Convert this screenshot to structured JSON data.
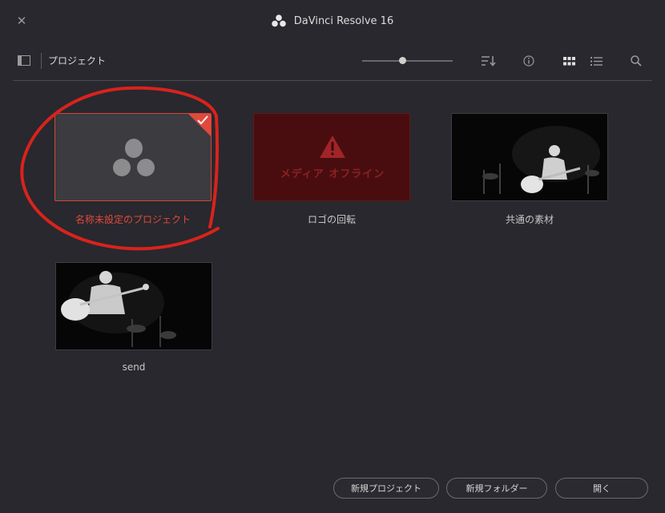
{
  "window": {
    "title": "DaVinci Resolve 16",
    "close_label": "✕"
  },
  "toolbar": {
    "breadcrumb": "プロジェクト",
    "zoom_level": 0.44,
    "icons": [
      "sidebar-toggle-icon",
      "sort-icon",
      "info-icon",
      "grid-view-icon",
      "list-view-icon",
      "search-icon"
    ]
  },
  "projects": [
    {
      "label": "名称未設定のプロジェクト",
      "state": "selected"
    },
    {
      "label": "ロゴの回転",
      "state": "offline",
      "overlay_text": "メディア オフライン"
    },
    {
      "label": "共通の素材",
      "state": "thumbnail"
    },
    {
      "label": "send",
      "state": "thumbnail"
    }
  ],
  "buttons": {
    "new_project": "新規プロジェクト",
    "new_folder": "新規フォルダー",
    "open": "開く"
  },
  "colors": {
    "accent": "#e0493c",
    "background": "#28282e",
    "offline_bg": "#4a0d0f"
  }
}
